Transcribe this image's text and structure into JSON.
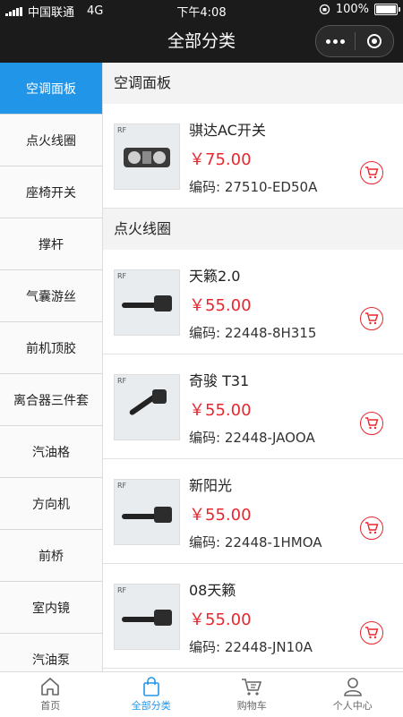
{
  "status": {
    "carrier": "中国联通",
    "network": "4G",
    "time": "下午4:08",
    "battery": "100%"
  },
  "nav": {
    "title": "全部分类"
  },
  "sidebar": {
    "items": [
      {
        "label": "空调面板"
      },
      {
        "label": "点火线圈"
      },
      {
        "label": "座椅开关"
      },
      {
        "label": "撑杆"
      },
      {
        "label": "气囊游丝"
      },
      {
        "label": "前机顶胶"
      },
      {
        "label": "离合器三件套"
      },
      {
        "label": "汽油格"
      },
      {
        "label": "方向机"
      },
      {
        "label": "前桥"
      },
      {
        "label": "室内镜"
      },
      {
        "label": "汽油泵"
      }
    ]
  },
  "main": {
    "sections": [
      {
        "header": "空调面板",
        "products": [
          {
            "name": "骐达AC开关",
            "price": "￥75.00",
            "code": "编码:  27510-ED50A",
            "logo": "RF"
          }
        ]
      },
      {
        "header": "点火线圈",
        "products": [
          {
            "name": "天籁2.0",
            "price": "￥55.00",
            "code": "编码:  22448-8H315",
            "logo": "RF"
          },
          {
            "name": "奇骏 T31",
            "price": "￥55.00",
            "code": "编码:  22448-JAOOA",
            "logo": "RF"
          },
          {
            "name": "新阳光",
            "price": "￥55.00",
            "code": "编码:  22448-1HMOA",
            "logo": "RF"
          },
          {
            "name": "08天籁",
            "price": "￥55.00",
            "code": "编码:  22448-JN10A",
            "logo": "RF"
          }
        ]
      }
    ]
  },
  "tabbar": {
    "items": [
      {
        "label": "首页",
        "icon": "home-icon"
      },
      {
        "label": "全部分类",
        "icon": "bag-icon"
      },
      {
        "label": "购物车",
        "icon": "cart-icon"
      },
      {
        "label": "个人中心",
        "icon": "user-icon"
      }
    ]
  },
  "colors": {
    "accent": "#2196e9",
    "price": "#e8262d",
    "nav_bg": "#1b1b1b"
  }
}
